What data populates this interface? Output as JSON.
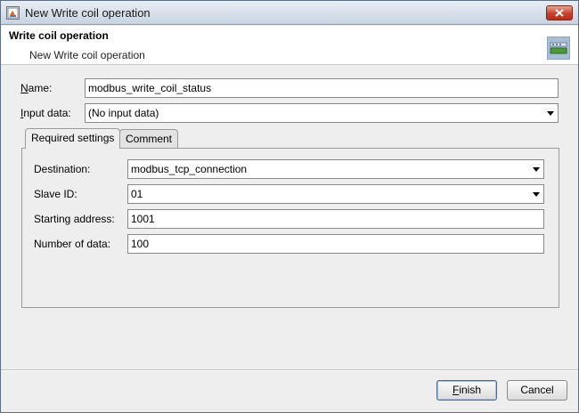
{
  "window": {
    "title": "New Write coil operation"
  },
  "header": {
    "title": "Write coil operation",
    "subtitle": "New Write coil operation"
  },
  "form": {
    "name_label": "Name:",
    "name_mnemonic": "N",
    "name_rest": "ame:",
    "name_value": "modbus_write_coil_status",
    "input_label": "Input data:",
    "input_mnemonic": "I",
    "input_rest": "nput data:",
    "input_value": "(No input data)"
  },
  "tabs": [
    {
      "label": "Required settings",
      "active": true
    },
    {
      "label": "Comment",
      "active": false
    }
  ],
  "settings": {
    "destination_label": "Destination:",
    "destination_value": "modbus_tcp_connection",
    "slave_label": "Slave ID:",
    "slave_value": "01",
    "start_label": "Starting address:",
    "start_value": "1001",
    "count_label": "Number of data:",
    "count_value": "100"
  },
  "buttons": {
    "finish_label": "Finish",
    "finish_mnemonic": "F",
    "finish_rest": "inish",
    "cancel_label": "Cancel"
  },
  "colors": {
    "close_button": "#c7402b",
    "header_icon": "#a8bdd6",
    "default_button_border": "#4a6a95"
  },
  "icons": {
    "app": "app-window-icon",
    "close": "close-icon",
    "header": "operation-icon",
    "combo": "chevron-down-icon"
  }
}
